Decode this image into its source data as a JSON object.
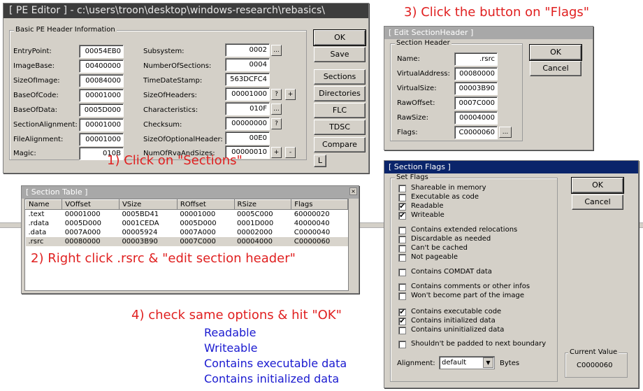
{
  "pe": {
    "title": "[ PE Editor ] - c:\\users\\troon\\desktop\\windows-research\\rebasics\\",
    "group": "Basic PE Header Information",
    "left": [
      {
        "label": "EntryPoint:",
        "value": "00054EB0"
      },
      {
        "label": "ImageBase:",
        "value": "00400000"
      },
      {
        "label": "SizeOfImage:",
        "value": "00084000"
      },
      {
        "label": "BaseOfCode:",
        "value": "00001000"
      },
      {
        "label": "BaseOfData:",
        "value": "0005D000"
      },
      {
        "label": "SectionAlignment:",
        "value": "00001000"
      },
      {
        "label": "FileAlignment:",
        "value": "00001000"
      },
      {
        "label": "Magic:",
        "value": "010B"
      }
    ],
    "right": [
      {
        "label": "Subsystem:",
        "value": "0002"
      },
      {
        "label": "NumberOfSections:",
        "value": "0004"
      },
      {
        "label": "TimeDateStamp:",
        "value": "563DCFC4"
      },
      {
        "label": "SizeOfHeaders:",
        "value": "00001000"
      },
      {
        "label": "Characteristics:",
        "value": "010F"
      },
      {
        "label": "Checksum:",
        "value": "00000000"
      },
      {
        "label": "SizeOfOptionalHeader:",
        "value": "00E0"
      },
      {
        "label": "NumOfRvaAndSizes:",
        "value": "00000010"
      }
    ],
    "small": {
      "dots": "...",
      "q": "?",
      "plus": "+",
      "minus": "-",
      "l": "L"
    },
    "buttons": [
      "OK",
      "Save",
      "Sections",
      "Directories",
      "FLC",
      "TDSC",
      "Compare"
    ]
  },
  "section_table": {
    "title": "[ Section Table ]",
    "columns": [
      "Name",
      "VOffset",
      "VSize",
      "ROffset",
      "RSize",
      "Flags"
    ],
    "rows": [
      [
        ".text",
        "00001000",
        "0005BD41",
        "00001000",
        "0005C000",
        "60000020"
      ],
      [
        ".rdata",
        "0005D000",
        "0001CEDA",
        "0005D000",
        "0001D000",
        "40000040"
      ],
      [
        ".data",
        "0007A000",
        "00005924",
        "0007A000",
        "00002000",
        "C0000040"
      ],
      [
        ".rsrc",
        "00080000",
        "00003B90",
        "0007C000",
        "00004000",
        "C0000060"
      ]
    ]
  },
  "edit": {
    "title": "[ Edit SectionHeader ]",
    "group": "Section Header",
    "fields": [
      {
        "label": "Name:",
        "value": ".rsrc"
      },
      {
        "label": "VirtualAddress:",
        "value": "00080000"
      },
      {
        "label": "VirtualSize:",
        "value": "00003B90"
      },
      {
        "label": "RawOffset:",
        "value": "0007C000"
      },
      {
        "label": "RawSize:",
        "value": "00004000"
      },
      {
        "label": "Flags:",
        "value": "C0000060"
      }
    ],
    "ok": "OK",
    "cancel": "Cancel",
    "dots": "..."
  },
  "flags": {
    "title": "[ Section Flags ]",
    "group": "Set Flags",
    "items": [
      {
        "label": "Shareable in memory",
        "checked": false
      },
      {
        "label": "Executable as code",
        "checked": false
      },
      {
        "label": "Readable",
        "checked": true
      },
      {
        "label": "Writeable",
        "checked": true
      },
      {
        "label": "Contains extended relocations",
        "checked": false
      },
      {
        "label": "Discardable as needed",
        "checked": false
      },
      {
        "label": "Can't be cached",
        "checked": false
      },
      {
        "label": "Not pageable",
        "checked": false
      },
      {
        "label": "Contains COMDAT data",
        "checked": false
      },
      {
        "label": "Contains comments or other infos",
        "checked": false
      },
      {
        "label": "Won't become part of the image",
        "checked": false
      },
      {
        "label": "Contains executable code",
        "checked": true
      },
      {
        "label": "Contains initialized data",
        "checked": true
      },
      {
        "label": "Contains uninitialized data",
        "checked": false
      },
      {
        "label": "Shouldn't be padded to next boundary",
        "checked": false
      }
    ],
    "alignment_label": "Alignment:",
    "alignment_value": "default",
    "bytes": "Bytes",
    "current_label": "Current Value",
    "current_value": "C0000060",
    "ok": "OK",
    "cancel": "Cancel",
    "check": "✔",
    "arrow": "▼"
  },
  "ann": {
    "a1": "1) Click on \"Sections\"",
    "a2": "2) Right click .rsrc & \"edit section header\"",
    "a3": "3) Click the button on \"Flags\"",
    "a4": "4) check same options & hit \"OK\"",
    "list": [
      "Readable",
      "Writeable",
      "Contains executable data",
      "Contains initialized data"
    ]
  }
}
